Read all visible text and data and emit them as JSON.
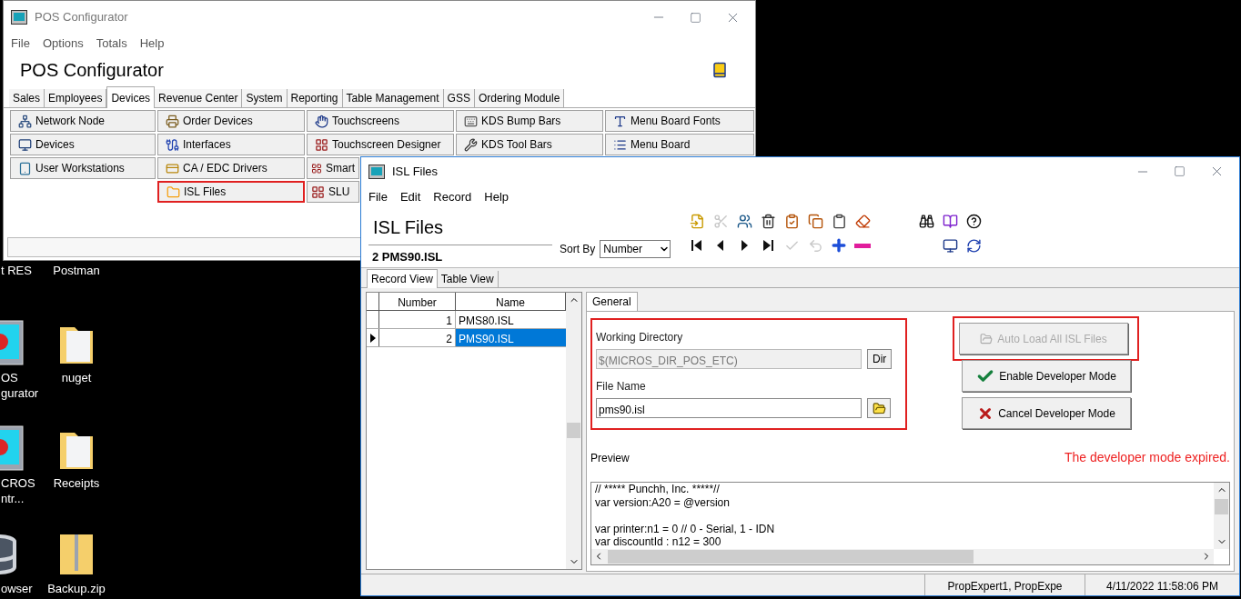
{
  "desktop": {
    "columns": [
      {
        "items": [
          {
            "label": "t RES",
            "kind": "none"
          },
          {
            "label": "OS\ngurator",
            "kind": "app"
          },
          {
            "label": "CROS\nntr...",
            "kind": "app"
          },
          {
            "label": "owser",
            "kind": "database"
          }
        ]
      },
      {
        "items": [
          {
            "label": "Postman",
            "kind": "none"
          },
          {
            "label": "nuget",
            "kind": "folder"
          },
          {
            "label": "Receipts",
            "kind": "folder"
          },
          {
            "label": "Backup.zip",
            "kind": "zip"
          }
        ]
      }
    ]
  },
  "pos_window": {
    "title": "POS Configurator",
    "menu": [
      "File",
      "Options",
      "Totals",
      "Help"
    ],
    "heading": "POS Configurator",
    "tabs": [
      {
        "label": "Sales",
        "selected": false
      },
      {
        "label": "Employees",
        "selected": false
      },
      {
        "label": "Devices",
        "selected": true
      },
      {
        "label": "Revenue Center",
        "selected": false
      },
      {
        "label": "System",
        "selected": false
      },
      {
        "label": "Reporting",
        "selected": false
      },
      {
        "label": "Table Management",
        "selected": false
      },
      {
        "label": "GSS",
        "selected": false
      },
      {
        "label": "Ordering Module",
        "selected": false
      }
    ],
    "columns": [
      [
        {
          "label": "Network Node",
          "kind": "network",
          "highlighted": false
        },
        {
          "label": "Devices",
          "kind": "computer",
          "highlighted": false
        },
        {
          "label": "User Workstations",
          "kind": "tablet",
          "highlighted": false
        }
      ],
      [
        {
          "label": "Order Devices",
          "kind": "printer",
          "highlighted": false
        },
        {
          "label": "Interfaces",
          "kind": "interfaces",
          "highlighted": false
        },
        {
          "label": "CA / EDC Drivers",
          "kind": "card",
          "highlighted": false
        },
        {
          "label": "ISL Files",
          "kind": "file",
          "highlighted": true
        }
      ],
      [
        {
          "label": "Touchscreens",
          "kind": "touch",
          "highlighted": false
        },
        {
          "label": "Touchscreen Designer",
          "kind": "grid",
          "highlighted": false
        },
        {
          "label": "Smart",
          "kind": "grid",
          "highlighted": false
        },
        {
          "label": "SLU",
          "kind": "grid",
          "highlighted": false
        }
      ],
      [
        {
          "label": "KDS Bump Bars",
          "kind": "keyboard",
          "highlighted": false
        },
        {
          "label": "KDS Tool Bars",
          "kind": "tools",
          "highlighted": false
        }
      ],
      [
        {
          "label": "Menu Board Fonts",
          "kind": "font",
          "highlighted": false
        },
        {
          "label": "Menu Board",
          "kind": "list",
          "highlighted": false
        }
      ]
    ]
  },
  "isl_window": {
    "title": "ISL Files",
    "menu": [
      "File",
      "Edit",
      "Record",
      "Help"
    ],
    "heading": "ISL Files",
    "current_record": "2 PMS90.ISL",
    "sort_by": {
      "label": "Sort By",
      "value": "Number"
    },
    "toolbar": [
      [
        {
          "kind": "paste",
          "disabled": false
        },
        {
          "kind": "cut",
          "disabled": true
        },
        {
          "kind": "users",
          "disabled": false
        },
        {
          "kind": "delete",
          "disabled": false
        },
        {
          "kind": "clipboard-check",
          "disabled": false
        },
        {
          "kind": "copy",
          "disabled": false
        },
        {
          "kind": "clipboard",
          "disabled": false
        },
        {
          "kind": "eraser",
          "disabled": false
        }
      ],
      [
        {
          "kind": "first",
          "disabled": false
        },
        {
          "kind": "prev",
          "disabled": false
        },
        {
          "kind": "next",
          "disabled": false
        },
        {
          "kind": "last",
          "disabled": false
        },
        {
          "kind": "confirm",
          "disabled": true
        },
        {
          "kind": "undo",
          "disabled": true
        },
        {
          "kind": "add",
          "disabled": false
        },
        {
          "kind": "remove",
          "disabled": false
        }
      ]
    ],
    "tools": [
      [
        {
          "kind": "search",
          "disabled": false
        },
        {
          "kind": "book",
          "disabled": false
        },
        {
          "kind": "help",
          "disabled": false
        }
      ],
      [
        {
          "kind": "monitor",
          "disabled": false
        },
        {
          "kind": "sync",
          "disabled": false
        }
      ]
    ],
    "view_tabs": [
      {
        "label": "Record View",
        "selected": true
      },
      {
        "label": "Table View",
        "selected": false
      }
    ],
    "table": {
      "columns": [
        "Number",
        "Name"
      ],
      "rows": [
        {
          "number": "1",
          "name": "PMS80.ISL",
          "selected": false
        },
        {
          "number": "2",
          "name": "PMS90.ISL",
          "selected": true
        }
      ]
    },
    "detail_tab": {
      "label": "General",
      "selected": true
    },
    "file_group": {
      "highlighted": true,
      "working_directory": {
        "label": "Working Directory",
        "value": "$(MICROS_DIR_POS_ETC)",
        "disabled": true,
        "button": "Dir"
      },
      "file_name": {
        "label": "File Name",
        "value": "pms90.isl",
        "disabled": false
      }
    },
    "buttons": [
      {
        "label": "Auto Load All ISL Files",
        "kind": "folder",
        "disabled": true,
        "highlighted": true
      },
      {
        "label": "Enable Developer Mode",
        "kind": "check",
        "disabled": false,
        "highlighted": false
      },
      {
        "label": "Cancel Developer Mode",
        "kind": "cross",
        "disabled": false,
        "highlighted": false
      }
    ],
    "preview": {
      "label": "Preview",
      "message": "The developer mode expired.",
      "text": "// ***** Punchh, Inc. *****//\nvar version:A20 = @version\n\nvar printer:n1 = 0 // 0 - Serial, 1 - IDN\nvar discountId : n12 = 300"
    },
    "status_bar": [
      "PropExpert1, PropExpe",
      "4/11/2022 11:58:06 PM"
    ]
  }
}
